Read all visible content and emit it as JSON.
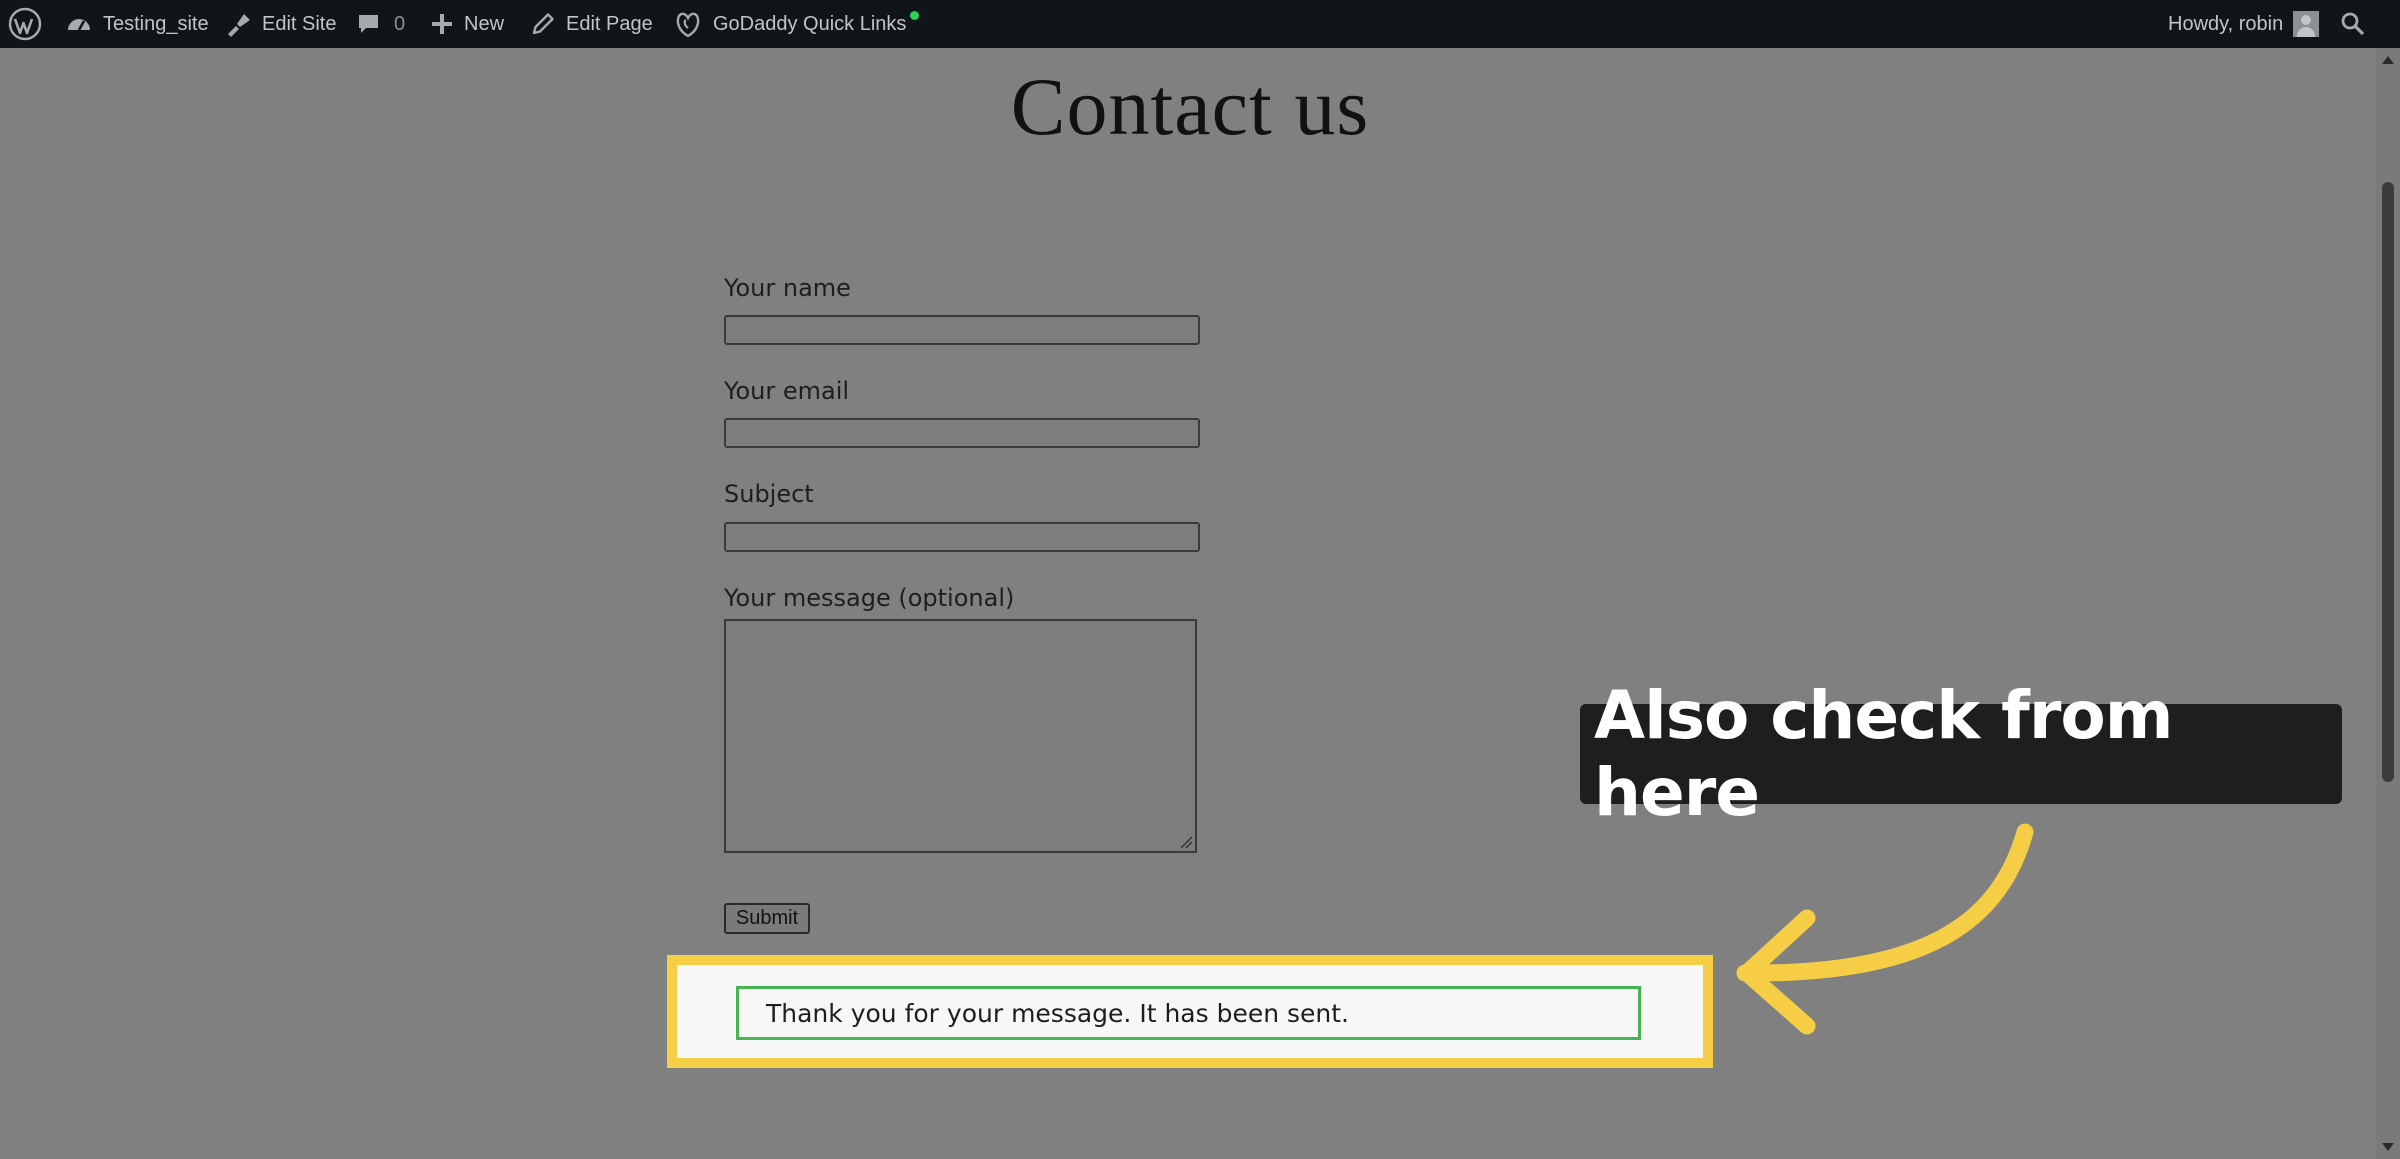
{
  "adminbar": {
    "site_name": "Testing_site",
    "edit_site": "Edit Site",
    "comments_count": "0",
    "new_label": "New",
    "edit_page": "Edit Page",
    "quick_links": "GoDaddy Quick Links",
    "howdy": "Howdy, robin"
  },
  "page": {
    "title": "Contact us"
  },
  "form": {
    "name_label": "Your name",
    "email_label": "Your email",
    "subject_label": "Subject",
    "message_label": "Your message (optional)",
    "submit_label": "Submit"
  },
  "response": {
    "message": "Thank you for your message. It has been sent."
  },
  "annotation": {
    "callout_text": "Also check from here"
  },
  "colors": {
    "overlay": "#808080",
    "adminbar_bg": "#101517",
    "highlight": "#f6ce46",
    "success_border": "#46b450",
    "callout_bg": "#1e1e1e"
  }
}
